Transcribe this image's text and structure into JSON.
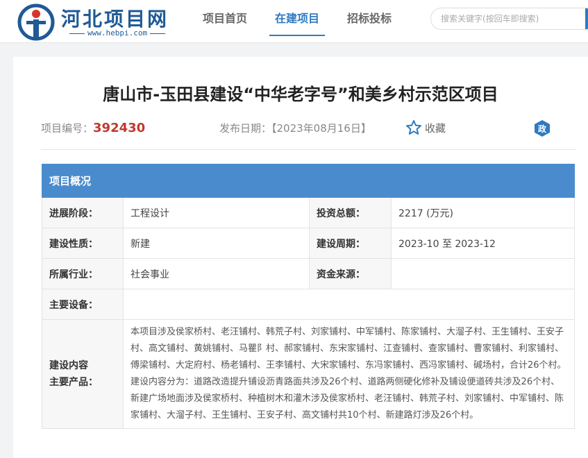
{
  "site": {
    "name": "河北项目网",
    "url": "www.hebpi.com"
  },
  "nav": {
    "items": [
      {
        "label": "项目首页",
        "active": false
      },
      {
        "label": "在建项目",
        "active": true
      },
      {
        "label": "招标投标",
        "active": false
      }
    ]
  },
  "search": {
    "placeholder": "搜索关键字(按回车即搜索)"
  },
  "project": {
    "title": "唐山市-玉田县建设“中华老字号”和美乡村示范区项目",
    "id_label": "项目编号：",
    "id_value": "392430",
    "date_label": "发布日期：【2023年08月16日】",
    "favorite_label": "收藏",
    "gov_badge": "政"
  },
  "overview": {
    "section_title": "项目概况",
    "rows": {
      "stage_label": "进展阶段：",
      "stage_value": "工程设计",
      "invest_label": "投资总额：",
      "invest_value": "2217 (万元)",
      "nature_label": "建设性质：",
      "nature_value": "新建",
      "period_label": "建设周期：",
      "period_value": "2023-10 至 2023-12",
      "industry_label": "所属行业：",
      "industry_value": "社会事业",
      "fund_label": "资金来源：",
      "fund_value": "",
      "equipment_label": "主要设备：",
      "equipment_value": "",
      "content_label_1": "建设内容",
      "content_label_2": "主要产品：",
      "content_value": "本项目涉及侯家桥村、老汪铺村、韩荒子村、刘家铺村、中军铺村、陈家铺村、大溜子村、王生铺村、王安子村、高文铺村、黄姚铺村、马瞿阝村、郝家铺村、东宋家铺村、江查铺村、查家铺村、曹家铺村、利家铺村、傅梁铺村、大定府村、杨老铺村、王李铺村、大宋家铺村、东冯家铺村、西冯家铺村、碱场村，合计26个村。建设内容分为：道路改造提升铺设沥青路面共涉及26个村、道路两侧硬化修补及铺设便道砖共涉及26个村、新建广场地面涉及侯家桥村、种植树木和灌木涉及侯家桥村、老汪铺村、韩荒子村、刘家铺村、中军铺村、陈家铺村、大溜子村、王生铺村、王安子村、高文铺村共10个村、新建路灯涉及26个村。"
    }
  },
  "colors": {
    "brand": "#1f5a96",
    "accent": "#2f7ac2",
    "section_header": "#4a8bcd",
    "project_id": "#c0392b"
  }
}
